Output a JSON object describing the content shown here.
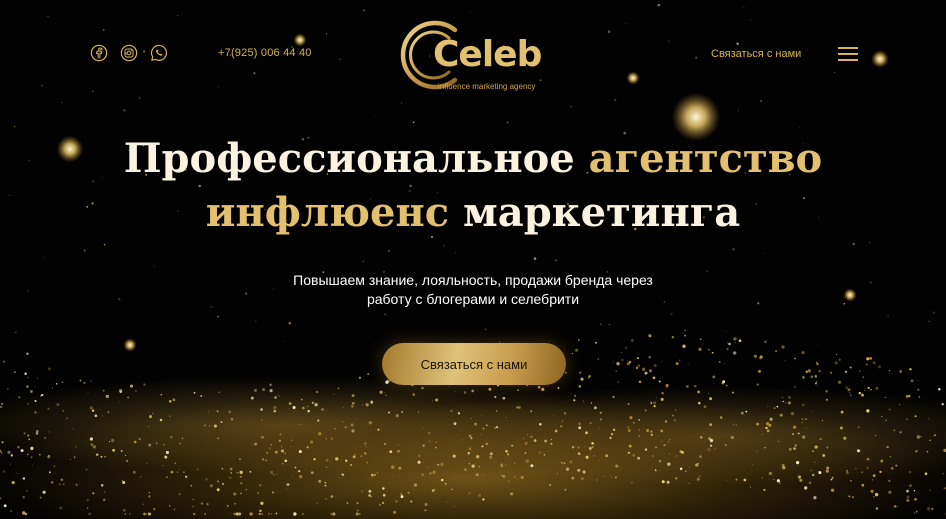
{
  "header": {
    "phone": "+7(925) 006 44 40",
    "contact_label": "Связаться с нами",
    "social": [
      "facebook-icon",
      "instagram-icon",
      "whatsapp-icon"
    ]
  },
  "logo": {
    "name": "Celeb",
    "tagline": "influence marketing agency"
  },
  "hero": {
    "title_line1_a": "Профессиональное ",
    "title_line1_b": "агентство",
    "title_line2_a": "инфлюенс ",
    "title_line2_b": "маркетинга",
    "subtitle_line1": "Повышаем знание, лояльность, продажи бренда через",
    "subtitle_line2": "работу с блогерами и селебрити",
    "cta_label": "Связаться с нами"
  },
  "colors": {
    "gold": "#e3c06f",
    "background": "#020202",
    "cream": "#fbf3df"
  }
}
